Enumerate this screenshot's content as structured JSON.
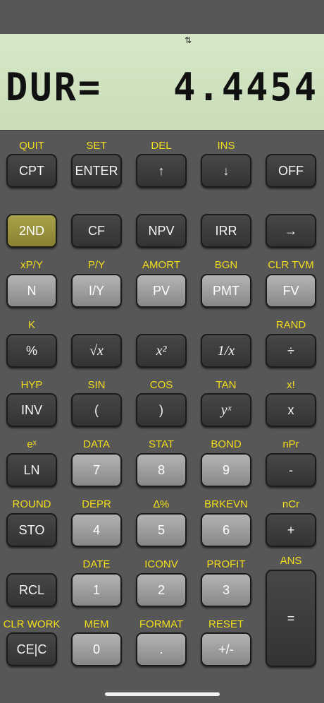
{
  "display": {
    "indicator": "⇅",
    "label": "DUR=",
    "value": "4.4454"
  },
  "rows": [
    {
      "secondary": [
        "QUIT",
        "SET",
        "DEL",
        "INS",
        ""
      ],
      "keys": [
        {
          "label": "CPT",
          "style": "dark",
          "name": "cpt-key"
        },
        {
          "label": "ENTER",
          "style": "dark",
          "name": "enter-key"
        },
        {
          "label": "↑",
          "style": "dark",
          "name": "up-arrow-key"
        },
        {
          "label": "↓",
          "style": "dark",
          "name": "down-arrow-key"
        },
        {
          "label": "OFF",
          "style": "dark",
          "name": "off-key"
        }
      ]
    },
    {
      "secondary": [
        "",
        "",
        "",
        "",
        ""
      ],
      "keys": [
        {
          "label": "2ND",
          "style": "yellow",
          "name": "second-key"
        },
        {
          "label": "CF",
          "style": "dark",
          "name": "cf-key"
        },
        {
          "label": "NPV",
          "style": "dark",
          "name": "npv-key"
        },
        {
          "label": "IRR",
          "style": "dark",
          "name": "irr-key"
        },
        {
          "label": "→",
          "style": "dark",
          "name": "right-arrow-key"
        }
      ]
    },
    {
      "secondary": [
        "xP/Y",
        "P/Y",
        "AMORT",
        "BGN",
        "CLR TVM"
      ],
      "keys": [
        {
          "label": "N",
          "style": "light",
          "name": "n-key"
        },
        {
          "label": "I/Y",
          "style": "light",
          "name": "iy-key"
        },
        {
          "label": "PV",
          "style": "light",
          "name": "pv-key"
        },
        {
          "label": "PMT",
          "style": "light",
          "name": "pmt-key"
        },
        {
          "label": "FV",
          "style": "light",
          "name": "fv-key"
        }
      ]
    },
    {
      "secondary": [
        "K",
        "",
        "",
        "",
        "RAND"
      ],
      "keys": [
        {
          "label": "%",
          "style": "dark",
          "name": "percent-key"
        },
        {
          "label": "√x",
          "style": "dark",
          "name": "sqrt-key",
          "italic": true
        },
        {
          "label": "x²",
          "style": "dark",
          "name": "square-key",
          "italic": true
        },
        {
          "label": "1/x",
          "style": "dark",
          "name": "reciprocal-key",
          "italic": true
        },
        {
          "label": "÷",
          "style": "dark",
          "name": "divide-key"
        }
      ]
    },
    {
      "secondary": [
        "HYP",
        "SIN",
        "COS",
        "TAN",
        "x!"
      ],
      "keys": [
        {
          "label": "INV",
          "style": "dark",
          "name": "inv-key"
        },
        {
          "label": "(",
          "style": "dark",
          "name": "open-paren-key"
        },
        {
          "label": ")",
          "style": "dark",
          "name": "close-paren-key"
        },
        {
          "label": "yˣ",
          "style": "dark",
          "name": "power-key",
          "italic": true
        },
        {
          "label": "x",
          "style": "dark",
          "name": "multiply-key"
        }
      ]
    },
    {
      "secondary": [
        "eˣ",
        "DATA",
        "STAT",
        "BOND",
        "nPr"
      ],
      "keys": [
        {
          "label": "LN",
          "style": "dark",
          "name": "ln-key"
        },
        {
          "label": "7",
          "style": "light",
          "name": "digit-7-key"
        },
        {
          "label": "8",
          "style": "light",
          "name": "digit-8-key"
        },
        {
          "label": "9",
          "style": "light",
          "name": "digit-9-key"
        },
        {
          "label": "-",
          "style": "dark",
          "name": "minus-key"
        }
      ]
    },
    {
      "secondary": [
        "ROUND",
        "DEPR",
        "∆%",
        "BRKEVN",
        "nCr"
      ],
      "keys": [
        {
          "label": "STO",
          "style": "dark",
          "name": "sto-key"
        },
        {
          "label": "4",
          "style": "light",
          "name": "digit-4-key"
        },
        {
          "label": "5",
          "style": "light",
          "name": "digit-5-key"
        },
        {
          "label": "6",
          "style": "light",
          "name": "digit-6-key"
        },
        {
          "label": "+",
          "style": "dark",
          "name": "plus-key"
        }
      ]
    },
    {
      "secondary": [
        "",
        "DATE",
        "ICONV",
        "PROFIT",
        "ANS"
      ],
      "keys": [
        {
          "label": "RCL",
          "style": "dark",
          "name": "rcl-key"
        },
        {
          "label": "1",
          "style": "light",
          "name": "digit-1-key"
        },
        {
          "label": "2",
          "style": "light",
          "name": "digit-2-key"
        },
        {
          "label": "3",
          "style": "light",
          "name": "digit-3-key"
        },
        {
          "label": "=",
          "style": "dark",
          "name": "equals-key",
          "tall": true
        }
      ]
    },
    {
      "secondary": [
        "CLR WORK",
        "MEM",
        "FORMAT",
        "RESET",
        ""
      ],
      "keys": [
        {
          "label": "CE|C",
          "style": "dark",
          "name": "ce-c-key"
        },
        {
          "label": "0",
          "style": "light",
          "name": "digit-0-key"
        },
        {
          "label": ".",
          "style": "light",
          "name": "decimal-key"
        },
        {
          "label": "+/-",
          "style": "light",
          "name": "sign-key"
        }
      ]
    }
  ]
}
